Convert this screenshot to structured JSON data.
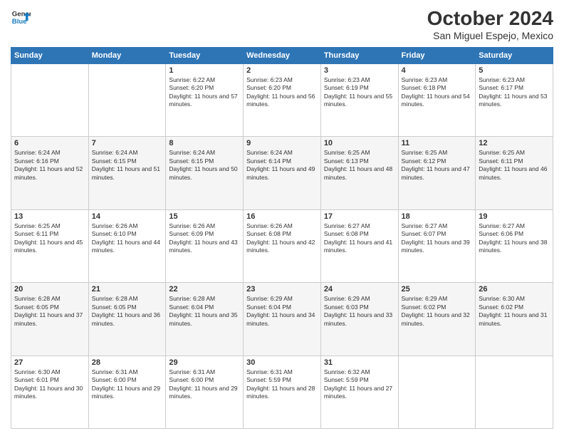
{
  "header": {
    "logo": {
      "line1": "General",
      "line2": "Blue"
    },
    "title": "October 2024",
    "subtitle": "San Miguel Espejo, Mexico"
  },
  "days_of_week": [
    "Sunday",
    "Monday",
    "Tuesday",
    "Wednesday",
    "Thursday",
    "Friday",
    "Saturday"
  ],
  "weeks": [
    [
      {
        "day": "",
        "text": ""
      },
      {
        "day": "",
        "text": ""
      },
      {
        "day": "1",
        "sunrise": "6:22 AM",
        "sunset": "6:20 PM",
        "daylight": "11 hours and 57 minutes."
      },
      {
        "day": "2",
        "sunrise": "6:23 AM",
        "sunset": "6:20 PM",
        "daylight": "11 hours and 56 minutes."
      },
      {
        "day": "3",
        "sunrise": "6:23 AM",
        "sunset": "6:19 PM",
        "daylight": "11 hours and 55 minutes."
      },
      {
        "day": "4",
        "sunrise": "6:23 AM",
        "sunset": "6:18 PM",
        "daylight": "11 hours and 54 minutes."
      },
      {
        "day": "5",
        "sunrise": "6:23 AM",
        "sunset": "6:17 PM",
        "daylight": "11 hours and 53 minutes."
      }
    ],
    [
      {
        "day": "6",
        "sunrise": "6:24 AM",
        "sunset": "6:16 PM",
        "daylight": "11 hours and 52 minutes."
      },
      {
        "day": "7",
        "sunrise": "6:24 AM",
        "sunset": "6:15 PM",
        "daylight": "11 hours and 51 minutes."
      },
      {
        "day": "8",
        "sunrise": "6:24 AM",
        "sunset": "6:15 PM",
        "daylight": "11 hours and 50 minutes."
      },
      {
        "day": "9",
        "sunrise": "6:24 AM",
        "sunset": "6:14 PM",
        "daylight": "11 hours and 49 minutes."
      },
      {
        "day": "10",
        "sunrise": "6:25 AM",
        "sunset": "6:13 PM",
        "daylight": "11 hours and 48 minutes."
      },
      {
        "day": "11",
        "sunrise": "6:25 AM",
        "sunset": "6:12 PM",
        "daylight": "11 hours and 47 minutes."
      },
      {
        "day": "12",
        "sunrise": "6:25 AM",
        "sunset": "6:11 PM",
        "daylight": "11 hours and 46 minutes."
      }
    ],
    [
      {
        "day": "13",
        "sunrise": "6:25 AM",
        "sunset": "6:11 PM",
        "daylight": "11 hours and 45 minutes."
      },
      {
        "day": "14",
        "sunrise": "6:26 AM",
        "sunset": "6:10 PM",
        "daylight": "11 hours and 44 minutes."
      },
      {
        "day": "15",
        "sunrise": "6:26 AM",
        "sunset": "6:09 PM",
        "daylight": "11 hours and 43 minutes."
      },
      {
        "day": "16",
        "sunrise": "6:26 AM",
        "sunset": "6:08 PM",
        "daylight": "11 hours and 42 minutes."
      },
      {
        "day": "17",
        "sunrise": "6:27 AM",
        "sunset": "6:08 PM",
        "daylight": "11 hours and 41 minutes."
      },
      {
        "day": "18",
        "sunrise": "6:27 AM",
        "sunset": "6:07 PM",
        "daylight": "11 hours and 39 minutes."
      },
      {
        "day": "19",
        "sunrise": "6:27 AM",
        "sunset": "6:06 PM",
        "daylight": "11 hours and 38 minutes."
      }
    ],
    [
      {
        "day": "20",
        "sunrise": "6:28 AM",
        "sunset": "6:05 PM",
        "daylight": "11 hours and 37 minutes."
      },
      {
        "day": "21",
        "sunrise": "6:28 AM",
        "sunset": "6:05 PM",
        "daylight": "11 hours and 36 minutes."
      },
      {
        "day": "22",
        "sunrise": "6:28 AM",
        "sunset": "6:04 PM",
        "daylight": "11 hours and 35 minutes."
      },
      {
        "day": "23",
        "sunrise": "6:29 AM",
        "sunset": "6:04 PM",
        "daylight": "11 hours and 34 minutes."
      },
      {
        "day": "24",
        "sunrise": "6:29 AM",
        "sunset": "6:03 PM",
        "daylight": "11 hours and 33 minutes."
      },
      {
        "day": "25",
        "sunrise": "6:29 AM",
        "sunset": "6:02 PM",
        "daylight": "11 hours and 32 minutes."
      },
      {
        "day": "26",
        "sunrise": "6:30 AM",
        "sunset": "6:02 PM",
        "daylight": "11 hours and 31 minutes."
      }
    ],
    [
      {
        "day": "27",
        "sunrise": "6:30 AM",
        "sunset": "6:01 PM",
        "daylight": "11 hours and 30 minutes."
      },
      {
        "day": "28",
        "sunrise": "6:31 AM",
        "sunset": "6:00 PM",
        "daylight": "11 hours and 29 minutes."
      },
      {
        "day": "29",
        "sunrise": "6:31 AM",
        "sunset": "6:00 PM",
        "daylight": "11 hours and 29 minutes."
      },
      {
        "day": "30",
        "sunrise": "6:31 AM",
        "sunset": "5:59 PM",
        "daylight": "11 hours and 28 minutes."
      },
      {
        "day": "31",
        "sunrise": "6:32 AM",
        "sunset": "5:59 PM",
        "daylight": "11 hours and 27 minutes."
      },
      {
        "day": "",
        "text": ""
      },
      {
        "day": "",
        "text": ""
      }
    ]
  ]
}
